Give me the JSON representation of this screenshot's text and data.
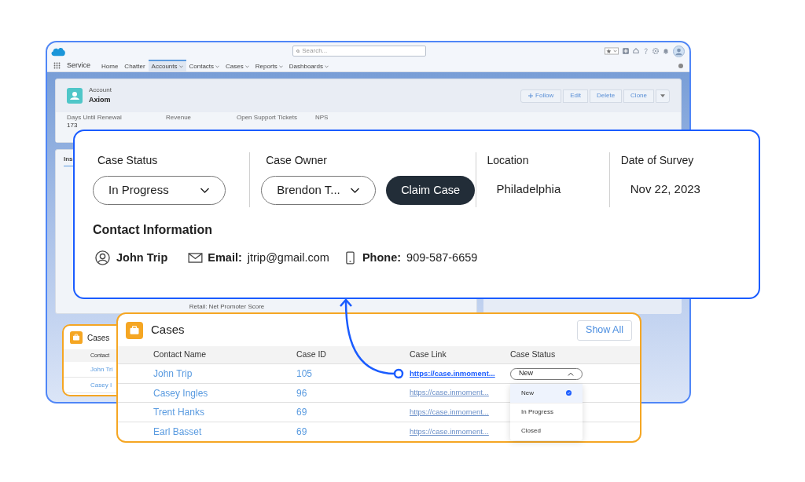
{
  "app": {
    "search": {
      "placeholder": "Search..."
    },
    "app_name": "Service",
    "nav": [
      {
        "label": "Home",
        "selected": false,
        "dropdown": false
      },
      {
        "label": "Chatter",
        "selected": false,
        "dropdown": false
      },
      {
        "label": "Accounts",
        "selected": true,
        "dropdown": true
      },
      {
        "label": "Contacts",
        "selected": false,
        "dropdown": true
      },
      {
        "label": "Cases",
        "selected": false,
        "dropdown": true
      },
      {
        "label": "Reports",
        "selected": false,
        "dropdown": true
      },
      {
        "label": "Dashboards",
        "selected": false,
        "dropdown": true
      }
    ],
    "account": {
      "type": "Account",
      "name": "Axiom",
      "follow": "Follow",
      "actions": [
        "Edit",
        "Delete",
        "Clone"
      ],
      "fields": [
        {
          "label": "Days Until Renewal",
          "value": "173"
        },
        {
          "label": "Revenue"
        },
        {
          "label": "Open Support Tickets"
        },
        {
          "label": "NPS"
        }
      ]
    },
    "tab": "Ins",
    "chart_caption": "Retail: Net Promoter Score",
    "mini_cases": {
      "title": "Cases",
      "column": "Contact",
      "rows": [
        "John Tri",
        "Casey I"
      ]
    }
  },
  "case_detail": {
    "fields": [
      {
        "label": "Case Status",
        "value": "In Progress",
        "kind": "dropdown"
      },
      {
        "label": "Case Owner",
        "value": "Brendon T...",
        "kind": "dropdown",
        "button": "Claim Case"
      },
      {
        "label": "Location",
        "value": "Philadelphia",
        "kind": "text"
      },
      {
        "label": "Date of Survey",
        "value": "Nov 22, 2023",
        "kind": "text"
      }
    ],
    "contact_title": "Contact Information",
    "contact_name": "John Trip",
    "email_label": "Email:",
    "email": "jtrip@gmail.com",
    "phone_label": "Phone:",
    "phone": "909-587-6659"
  },
  "cases": {
    "title": "Cases",
    "show_all": "Show All",
    "columns": [
      "Contact Name",
      "Case ID",
      "Case Link",
      "Case Status"
    ],
    "rows": [
      {
        "name": "John Trip",
        "id": "105",
        "link": "https://case.inmoment...",
        "highlighted": true,
        "status": {
          "value": "New",
          "expanded": true,
          "options": [
            {
              "label": "New",
              "selected": true
            },
            {
              "label": "In Progress",
              "selected": false
            },
            {
              "label": "Closed",
              "selected": false
            }
          ]
        }
      },
      {
        "name": "Casey Ingles",
        "id": "96",
        "link": "https://case.inmoment...",
        "highlighted": false
      },
      {
        "name": "Trent Hanks",
        "id": "69",
        "link": "https://case.inmoment...",
        "highlighted": false
      },
      {
        "name": "Earl Basset",
        "id": "69",
        "link": "https://case.inmoment...",
        "highlighted": false
      }
    ]
  }
}
